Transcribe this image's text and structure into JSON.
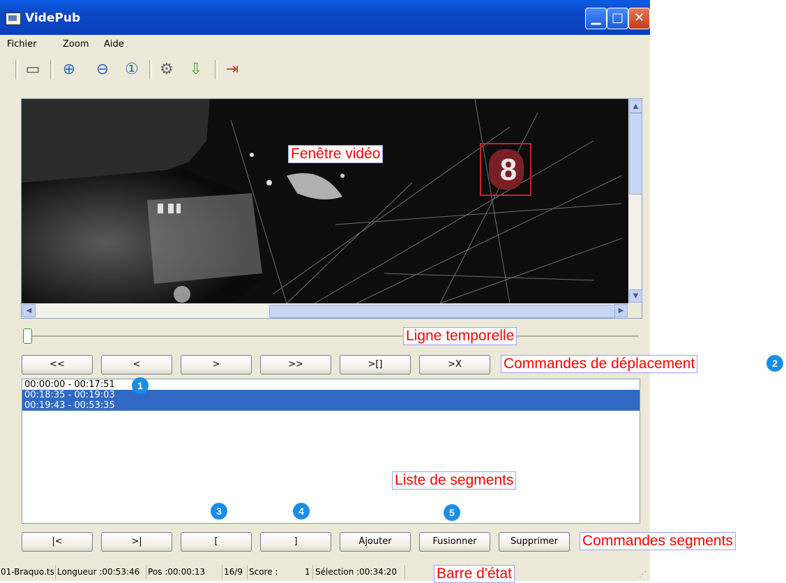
{
  "window": {
    "title": "VidePub",
    "min_icon": "minimize-icon",
    "max_icon": "maximize-icon",
    "close_icon": "close-icon"
  },
  "menu": {
    "items": [
      "Fichier",
      "Zoom",
      "Aide"
    ]
  },
  "toolbar": {
    "icons": [
      "open-icon",
      "zoom-in-icon",
      "zoom-out-icon",
      "zoom-reset-icon",
      "settings-icon",
      "save-icon",
      "exit-icon"
    ]
  },
  "annotations": {
    "video": "Fenêtre vidéo",
    "timeline": "Ligne temporelle",
    "move_commands": "Commandes de déplacement",
    "segments": "Liste de segments",
    "segment_commands": "Commandes segments",
    "status": "Barre d'état"
  },
  "badges": [
    "1",
    "2",
    "3",
    "4",
    "5"
  ],
  "video_logo": "8",
  "timeline": {
    "position": 0.0
  },
  "move_buttons": [
    "<<",
    "<",
    ">",
    ">>",
    ">[]",
    ">X"
  ],
  "segments": [
    {
      "label": "00:00:00 - 00:17:51",
      "selected": false
    },
    {
      "label": "00:18:35 - 00:19:03",
      "selected": true
    },
    {
      "label": "00:19:43 - 00:53:35",
      "selected": true
    }
  ],
  "segment_buttons": [
    "|<",
    ">|",
    "[",
    "]",
    "Ajouter",
    "Fusionner",
    "Supprimer"
  ],
  "status": {
    "file": "01-Braquo.ts",
    "length": "Longueur :00:53:46",
    "pos": "Pos :00:00:13",
    "ratio": "16/9",
    "score": "Score :",
    "score_value": "1",
    "selection": "Sélection :00:34:20"
  },
  "colors": {
    "accent": "#316ac5",
    "annotation": "#ff0000",
    "badge": "#1a8ee6",
    "titlebar": "#0a5be2"
  }
}
